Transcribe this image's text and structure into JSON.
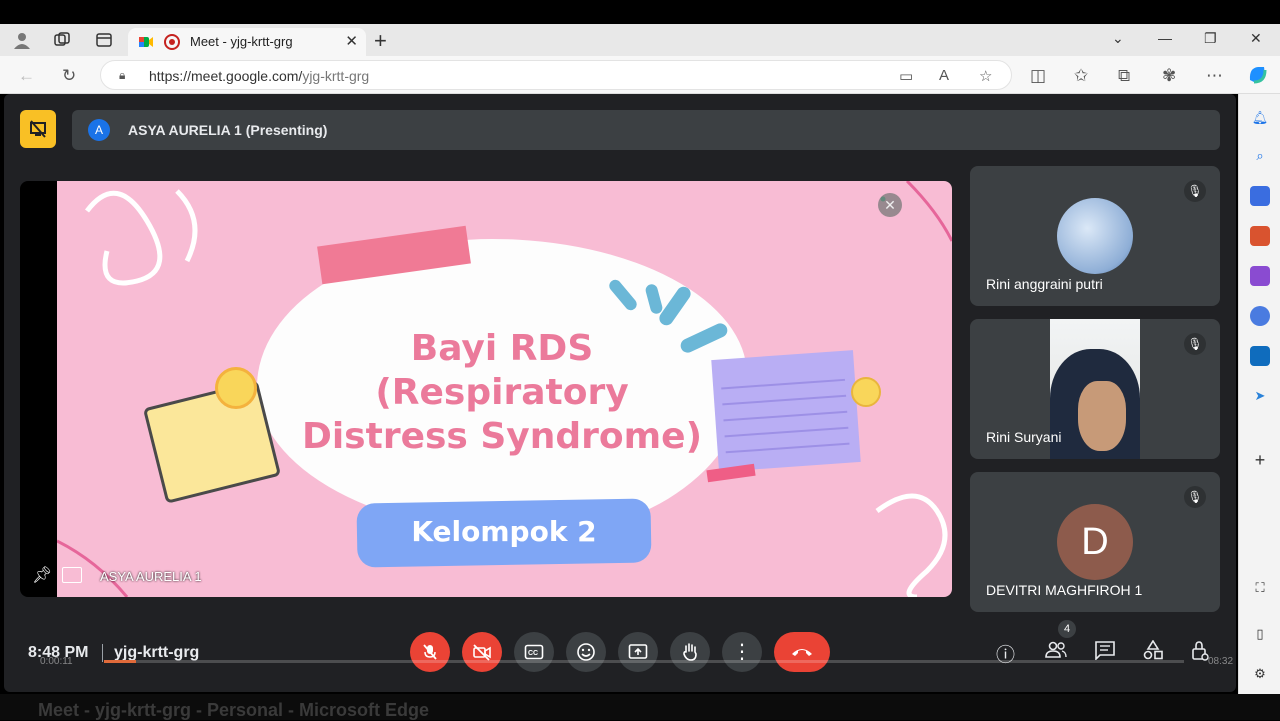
{
  "browser": {
    "tab_title": "Meet - yjg-krtt-grg",
    "url_host": "https://meet.google.com/",
    "url_path": "yjg-krtt-grg",
    "tab_close": "✕",
    "new_tab": "+"
  },
  "meet": {
    "presenter_initial": "A",
    "presenting_text": "ASYA AURELIA 1 (Presenting)",
    "stage_name": "ASYA AURELIA 1",
    "slide": {
      "title_line1": "Bayi RDS",
      "title_line2": "(Respiratory",
      "title_line3": "Distress Syndrome)",
      "subtitle": "Kelompok 2"
    },
    "participants": [
      {
        "name": "Rini anggraini putri",
        "muted": true
      },
      {
        "name": "Rini Suryani",
        "muted": true
      },
      {
        "name": "DEVITRI MAGHFIROH 1",
        "muted": true,
        "initial": "D"
      }
    ],
    "time": "8:48 PM",
    "meeting_code": "yjg-krtt-grg",
    "participant_count": "4"
  },
  "video_player": {
    "elapsed": "0:00:11",
    "remaining": "08:32",
    "progress": 0.03,
    "window_title": "Meet - yjg-krtt-grg - Personal - Microsoft Edge"
  },
  "colors": {
    "accent_red": "#ea4335",
    "present_yellow": "#f9c025",
    "meet_bg": "#202124"
  }
}
